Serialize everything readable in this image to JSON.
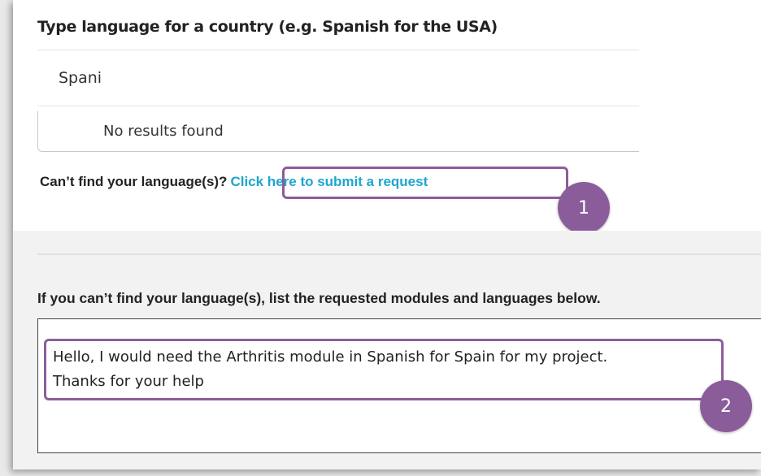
{
  "language_search": {
    "label": "Type language for a country (e.g. Spanish for the USA)",
    "value": "Spani",
    "no_results": "No results found"
  },
  "request": {
    "question": "Can’t find your language(s)?",
    "link": "Click here to submit a request"
  },
  "annotations": {
    "badge_1": "1",
    "badge_2": "2",
    "color": "#8b5c9a"
  },
  "request_form": {
    "label": "If you can’t find your language(s), list the requested modules and languages below.",
    "value": "Hello, I would need the Arthritis module in Spanish for Spain for my project.\nThanks for your help"
  },
  "colors": {
    "link": "#1ba6cf",
    "bottom_background": "#f2f2f2"
  }
}
